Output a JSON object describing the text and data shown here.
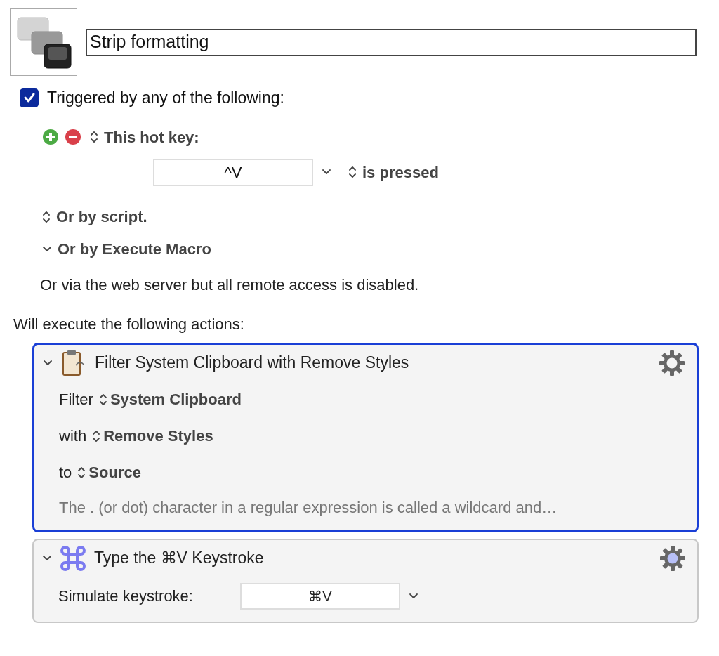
{
  "macro": {
    "name": "Strip formatting"
  },
  "trigger": {
    "label": "Triggered by any of the following:",
    "checked": true
  },
  "hot_key": {
    "label": "This hot key:",
    "key": "^V",
    "condition": "is pressed"
  },
  "other_triggers": [
    {
      "label": "Or by script.",
      "expanded": false
    },
    {
      "label": "Or by Execute Macro",
      "expanded": true
    }
  ],
  "web_note": "Or via the web server but all remote access is disabled.",
  "actions_heading": "Will execute the following actions:",
  "actions": [
    {
      "kind": "filter",
      "title": "Filter System Clipboard with Remove Styles",
      "selected": true,
      "expanded": true,
      "rows": [
        {
          "label": "Filter",
          "value": "System Clipboard"
        },
        {
          "label": "with",
          "value": "Remove Styles"
        },
        {
          "label": "to",
          "value": "Source"
        }
      ],
      "note": "The . (or dot) character in a regular expression is called a wildcard and…"
    },
    {
      "kind": "keystroke",
      "title": "Type the ⌘V Keystroke",
      "selected": false,
      "expanded": true,
      "field_label": "Simulate keystroke:",
      "keystroke": "⌘V"
    }
  ]
}
